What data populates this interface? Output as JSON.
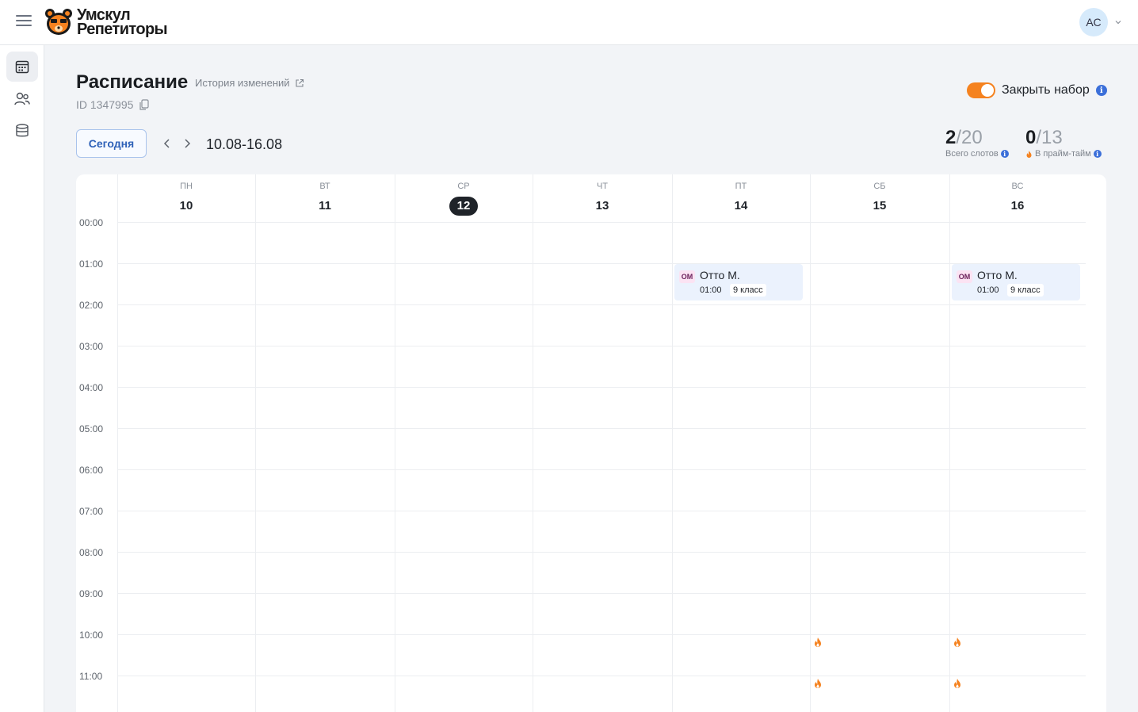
{
  "brand": {
    "line1": "Умскул",
    "line2": "Репетиторы",
    "accent": "#f5821f"
  },
  "user": {
    "initials": "АС"
  },
  "sidebar": {
    "items": [
      {
        "icon": "calendar-icon",
        "active": true
      },
      {
        "icon": "users-icon",
        "active": false
      },
      {
        "icon": "database-icon",
        "active": false
      }
    ]
  },
  "page": {
    "title": "Расписание",
    "history_link": "История изменений",
    "id_text": "ID 1347995",
    "close_enrollment_label": "Закрыть набор",
    "close_enrollment_on": true
  },
  "toolbar": {
    "today_label": "Сегодня",
    "range": "10.08-16.08"
  },
  "stats": {
    "slots": {
      "value": "2",
      "total": "/20",
      "label": "Всего слотов"
    },
    "prime": {
      "value": "0",
      "total": "/13",
      "label": "В прайм-тайм"
    }
  },
  "calendar": {
    "days": [
      {
        "name": "ПН",
        "date": "10",
        "today": false
      },
      {
        "name": "ВТ",
        "date": "11",
        "today": false
      },
      {
        "name": "СР",
        "date": "12",
        "today": true
      },
      {
        "name": "ЧТ",
        "date": "13",
        "today": false
      },
      {
        "name": "ПТ",
        "date": "14",
        "today": false
      },
      {
        "name": "СБ",
        "date": "15",
        "today": false
      },
      {
        "name": "ВС",
        "date": "16",
        "today": false
      }
    ],
    "hours": [
      "00:00",
      "01:00",
      "02:00",
      "03:00",
      "04:00",
      "05:00",
      "06:00",
      "07:00",
      "08:00",
      "09:00",
      "10:00",
      "11:00"
    ],
    "events": [
      {
        "day": 4,
        "hour": 1,
        "badge": "ОМ",
        "name": "Отто М.",
        "time": "01:00",
        "grade": "9 класс"
      },
      {
        "day": 6,
        "hour": 1,
        "badge": "ОМ",
        "name": "Отто М.",
        "time": "01:00",
        "grade": "9 класс"
      }
    ],
    "prime_markers": [
      {
        "day": 5,
        "hour": 10
      },
      {
        "day": 6,
        "hour": 10
      },
      {
        "day": 5,
        "hour": 11
      },
      {
        "day": 6,
        "hour": 11
      }
    ]
  }
}
